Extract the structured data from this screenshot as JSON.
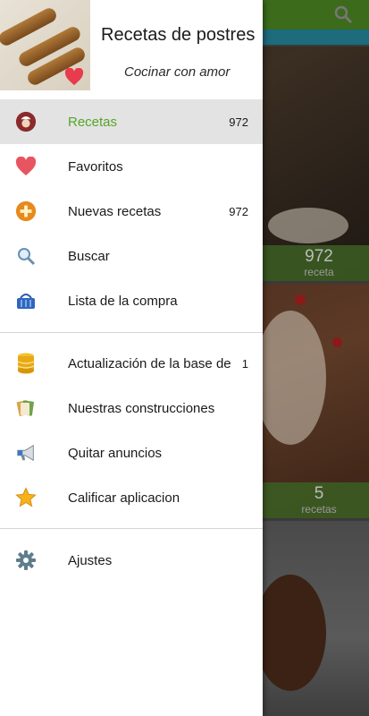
{
  "header": {
    "app_title": "Recetas de postres",
    "app_subtitle": "Cocinar con amor"
  },
  "menu": {
    "items": [
      {
        "label": "Recetas",
        "count": "972",
        "icon": "chef-avatar-icon",
        "selected": true
      },
      {
        "label": "Favoritos",
        "count": "",
        "icon": "heart-icon"
      },
      {
        "label": "Nuevas recetas",
        "count": "972",
        "icon": "add-circle-icon"
      },
      {
        "label": "Buscar",
        "count": "",
        "icon": "search-icon"
      },
      {
        "label": "Lista de la compra",
        "count": "",
        "icon": "shopping-basket-icon"
      },
      {
        "label": "Actualización de la base de",
        "count": "1",
        "icon": "database-icon"
      },
      {
        "label": "Nuestras construcciones",
        "count": "",
        "icon": "apps-icon"
      },
      {
        "label": "Quitar anuncios",
        "count": "",
        "icon": "megaphone-icon"
      },
      {
        "label": "Calificar aplicacion",
        "count": "",
        "icon": "star-icon"
      },
      {
        "label": "Ajustes",
        "count": "",
        "icon": "gear-icon"
      }
    ]
  },
  "background": {
    "card1": {
      "count": "972",
      "unit": "receta"
    },
    "card2": {
      "count": "5",
      "unit": "recetas"
    }
  },
  "colors": {
    "accent_green": "#55a626",
    "selected_bg": "#e3e3e3",
    "topbar_green": "#3b6b1b",
    "tabbar_teal": "#1d6b7c"
  }
}
